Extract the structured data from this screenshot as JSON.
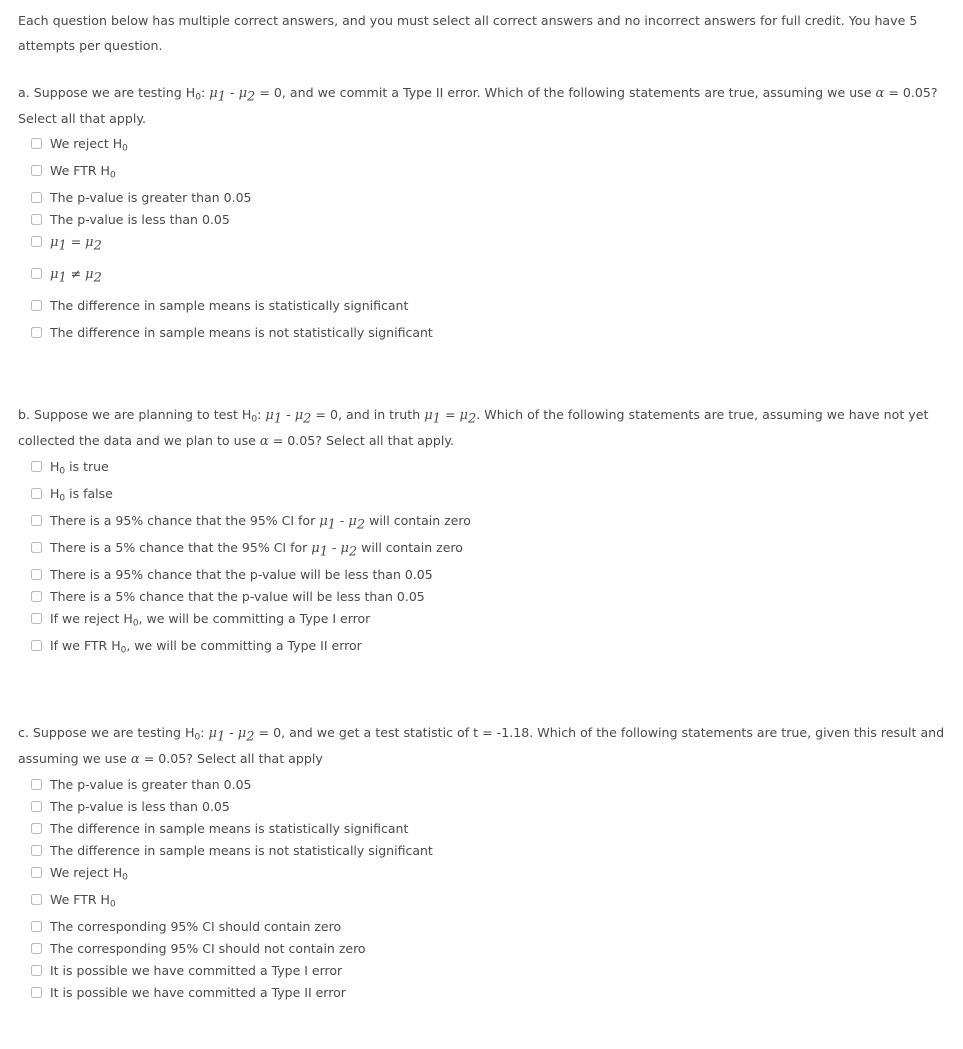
{
  "intro": {
    "text": "Each question below has multiple correct answers, and you must select all correct answers and no incorrect answers for full credit. You have 5 attempts per question."
  },
  "checkbox_style": {
    "border_color": "#b9b9b9",
    "fill_color": "#ffffff",
    "checked": false
  },
  "text_color": "#4a4a4a",
  "background_color": "#ffffff",
  "questions": [
    {
      "id": "a",
      "prompt_plain": "a. Suppose we are testing H0: μ1 - μ2 = 0, and we commit a Type II error. Which of the following statements are true, assuming we use α = 0.05? Select all that apply.",
      "prompt_html": "a. Suppose we are testing H<sub>0</sub>: <span class=\"mi\">μ</span><sub class=\"mi\">1</sub> - <span class=\"mi\">μ</span><sub class=\"mi\">2</sub> = 0, and we commit a Type II error. Which of the following statements are true, assuming we use <span class=\"mi\">α</span> = 0.05? Select all that apply.",
      "options": [
        {
          "plain": "We reject H0",
          "html": "We reject H<sub>0</sub>",
          "size": "tall",
          "checked": false
        },
        {
          "plain": "We FTR H0",
          "html": "We FTR H<sub>0</sub>",
          "size": "tall",
          "checked": false
        },
        {
          "plain": "The p-value is greater than 0.05",
          "html": "The p-value is greater than 0.05",
          "size": "normal",
          "checked": false
        },
        {
          "plain": "The p-value is less than 0.05",
          "html": "The p-value is less than 0.05",
          "size": "normal",
          "checked": false
        },
        {
          "plain": "μ1 = μ2",
          "html": "<span class=\"mi\">μ</span><sub class=\"mi\">1</sub> = <span class=\"mi\">μ</span><sub class=\"mi\">2</sub>",
          "size": "extra",
          "checked": false
        },
        {
          "plain": "μ1 ≠ μ2",
          "html": "<span class=\"mi\">μ</span><sub class=\"mi\">1</sub> ≠ <span class=\"mi\">μ</span><sub class=\"mi\">2</sub>",
          "size": "extra",
          "checked": false
        },
        {
          "plain": "The difference in sample means is statistically significant",
          "html": "The difference in sample means is statistically significant",
          "size": "tall",
          "checked": false
        },
        {
          "plain": "The difference in sample means is not statistically significant",
          "html": "The difference in sample means is not statistically significant",
          "size": "normal",
          "checked": false
        }
      ]
    },
    {
      "id": "b",
      "prompt_plain": "b. Suppose we are planning to test H0: μ1 - μ2 = 0, and in truth μ1 = μ2. Which of the following statements are true, assuming we have not yet collected the data and we plan to use α = 0.05? Select all that apply.",
      "prompt_html": "b. Suppose we are planning to test H<sub>0</sub>: <span class=\"mi\">μ</span><sub class=\"mi\">1</sub> - <span class=\"mi\">μ</span><sub class=\"mi\">2</sub> = 0, and in truth <span class=\"mi\">μ</span><sub class=\"mi\">1</sub> = <span class=\"mi\">μ</span><sub class=\"mi\">2</sub>. Which of the following statements are true, assuming we have not yet collected the data and we plan to use <span class=\"mi\">α</span> = 0.05? Select all that apply.",
      "options": [
        {
          "plain": "H0 is true",
          "html": "H<sub>0</sub> is true",
          "size": "tall",
          "checked": false
        },
        {
          "plain": "H0 is false",
          "html": "H<sub>0</sub> is false",
          "size": "tall",
          "checked": false
        },
        {
          "plain": "There is a 95% chance that the 95% CI for μ1 - μ2 will contain zero",
          "html": "There is a 95% chance that the 95% CI for <span class=\"mi\">μ</span><sub class=\"mi\">1</sub> - <span class=\"mi\">μ</span><sub class=\"mi\">2</sub> will contain zero",
          "size": "tall",
          "checked": false
        },
        {
          "plain": "There is a 5% chance that the 95% CI for μ1 - μ2 will contain zero",
          "html": "There is a 5% chance that the 95% CI for <span class=\"mi\">μ</span><sub class=\"mi\">1</sub> - <span class=\"mi\">μ</span><sub class=\"mi\">2</sub> will contain zero",
          "size": "tall",
          "checked": false
        },
        {
          "plain": "There is a 95% chance that the p-value will be less than 0.05",
          "html": "There is a 95% chance that the p-value will be less than 0.05",
          "size": "normal",
          "checked": false
        },
        {
          "plain": "There is a 5% chance that the p-value will be less than 0.05",
          "html": "There is a 5% chance that the p-value will be less than 0.05",
          "size": "normal",
          "checked": false
        },
        {
          "plain": "If we reject H0, we will be committing a Type I error",
          "html": "If we reject H<sub>0</sub>, we will be committing a Type I error",
          "size": "tall",
          "checked": false
        },
        {
          "plain": "If we FTR H0, we will be committing a Type II error",
          "html": "If we FTR H<sub>0</sub>, we will be committing a Type II error",
          "size": "tall",
          "checked": false
        }
      ]
    },
    {
      "id": "c",
      "prompt_plain": "c. Suppose we are testing H0: μ1 - μ2 = 0, and we get a test statistic of t = -1.18. Which of the following statements are true, given this result and assuming we use α = 0.05? Select all that apply",
      "prompt_html": "c. Suppose we are testing H<sub>0</sub>: <span class=\"mi\">μ</span><sub class=\"mi\">1</sub> - <span class=\"mi\">μ</span><sub class=\"mi\">2</sub> = 0, and we get a test statistic of t = -1.18. Which of the following statements are true, given this result and assuming we use <span class=\"mi\">α</span> = 0.05? Select all that apply",
      "options": [
        {
          "plain": "The p-value is greater than 0.05",
          "html": "The p-value is greater than 0.05",
          "size": "normal",
          "checked": false
        },
        {
          "plain": "The p-value is less than 0.05",
          "html": "The p-value is less than 0.05",
          "size": "normal",
          "checked": false
        },
        {
          "plain": "The difference in sample means is statistically significant",
          "html": "The difference in sample means is statistically significant",
          "size": "normal",
          "checked": false
        },
        {
          "plain": "The difference in sample means is not statistically significant",
          "html": "The difference in sample means is not statistically significant",
          "size": "normal",
          "checked": false
        },
        {
          "plain": "We reject H0",
          "html": "We reject H<sub>0</sub>",
          "size": "tall",
          "checked": false
        },
        {
          "plain": "We FTR H0",
          "html": "We FTR H<sub>0</sub>",
          "size": "tall",
          "checked": false
        },
        {
          "plain": "The corresponding 95% CI should contain zero",
          "html": "The corresponding 95% CI should contain zero",
          "size": "normal",
          "checked": false
        },
        {
          "plain": "The corresponding 95% CI should not contain zero",
          "html": "The corresponding 95% CI should not contain zero",
          "size": "normal",
          "checked": false
        },
        {
          "plain": "It is possible we have committed a Type I error",
          "html": "It is possible we have committed a Type I error",
          "size": "normal",
          "checked": false
        },
        {
          "plain": "It is possible we have committed a Type II error",
          "html": "It is possible we have committed a Type II error",
          "size": "normal",
          "checked": false
        }
      ]
    }
  ]
}
